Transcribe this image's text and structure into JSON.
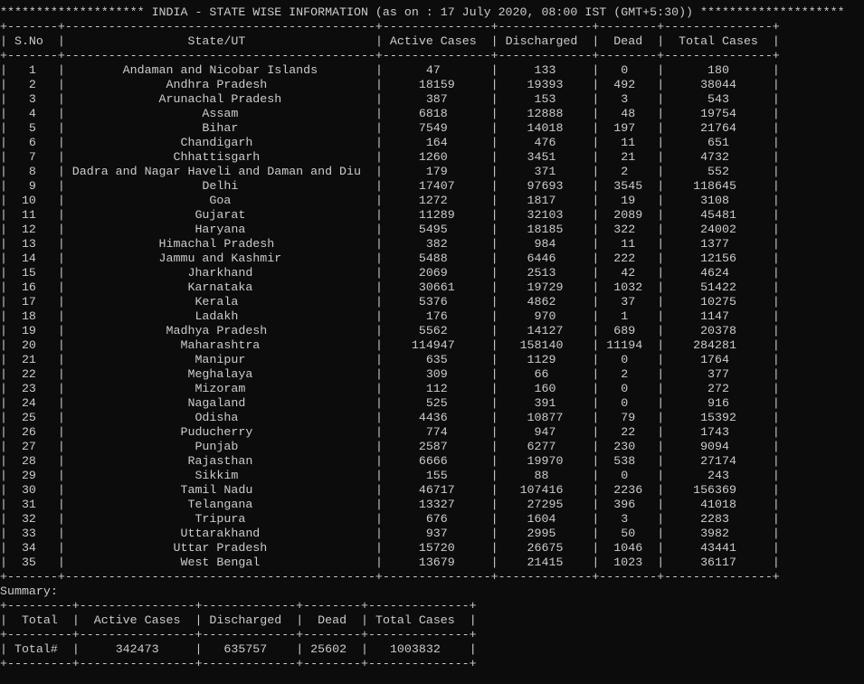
{
  "header": {
    "title": "INDIA - STATE WISE INFORMATION",
    "timestamp": "(as on : 17 July 2020, 08:00 IST (GMT+5:30))"
  },
  "state_table": {
    "columns": [
      "S.No",
      "State/UT",
      "Active Cases",
      "Discharged",
      "Dead",
      "Total Cases"
    ],
    "rows": [
      [
        "1",
        "Andaman and Nicobar Islands",
        "47",
        "133",
        "0",
        "180"
      ],
      [
        "2",
        "Andhra Pradesh",
        "18159",
        "19393",
        "492",
        "38044"
      ],
      [
        "3",
        "Arunachal Pradesh",
        "387",
        "153",
        "3",
        "543"
      ],
      [
        "4",
        "Assam",
        "6818",
        "12888",
        "48",
        "19754"
      ],
      [
        "5",
        "Bihar",
        "7549",
        "14018",
        "197",
        "21764"
      ],
      [
        "6",
        "Chandigarh",
        "164",
        "476",
        "11",
        "651"
      ],
      [
        "7",
        "Chhattisgarh",
        "1260",
        "3451",
        "21",
        "4732"
      ],
      [
        "8",
        "Dadra and Nagar Haveli and Daman and Diu",
        "179",
        "371",
        "2",
        "552"
      ],
      [
        "9",
        "Delhi",
        "17407",
        "97693",
        "3545",
        "118645"
      ],
      [
        "10",
        "Goa",
        "1272",
        "1817",
        "19",
        "3108"
      ],
      [
        "11",
        "Gujarat",
        "11289",
        "32103",
        "2089",
        "45481"
      ],
      [
        "12",
        "Haryana",
        "5495",
        "18185",
        "322",
        "24002"
      ],
      [
        "13",
        "Himachal Pradesh",
        "382",
        "984",
        "11",
        "1377"
      ],
      [
        "14",
        "Jammu and Kashmir",
        "5488",
        "6446",
        "222",
        "12156"
      ],
      [
        "15",
        "Jharkhand",
        "2069",
        "2513",
        "42",
        "4624"
      ],
      [
        "16",
        "Karnataka",
        "30661",
        "19729",
        "1032",
        "51422"
      ],
      [
        "17",
        "Kerala",
        "5376",
        "4862",
        "37",
        "10275"
      ],
      [
        "18",
        "Ladakh",
        "176",
        "970",
        "1",
        "1147"
      ],
      [
        "19",
        "Madhya Pradesh",
        "5562",
        "14127",
        "689",
        "20378"
      ],
      [
        "20",
        "Maharashtra",
        "114947",
        "158140",
        "11194",
        "284281"
      ],
      [
        "21",
        "Manipur",
        "635",
        "1129",
        "0",
        "1764"
      ],
      [
        "22",
        "Meghalaya",
        "309",
        "66",
        "2",
        "377"
      ],
      [
        "23",
        "Mizoram",
        "112",
        "160",
        "0",
        "272"
      ],
      [
        "24",
        "Nagaland",
        "525",
        "391",
        "0",
        "916"
      ],
      [
        "25",
        "Odisha",
        "4436",
        "10877",
        "79",
        "15392"
      ],
      [
        "26",
        "Puducherry",
        "774",
        "947",
        "22",
        "1743"
      ],
      [
        "27",
        "Punjab",
        "2587",
        "6277",
        "230",
        "9094"
      ],
      [
        "28",
        "Rajasthan",
        "6666",
        "19970",
        "538",
        "27174"
      ],
      [
        "29",
        "Sikkim",
        "155",
        "88",
        "0",
        "243"
      ],
      [
        "30",
        "Tamil Nadu",
        "46717",
        "107416",
        "2236",
        "156369"
      ],
      [
        "31",
        "Telangana",
        "13327",
        "27295",
        "396",
        "41018"
      ],
      [
        "32",
        "Tripura",
        "676",
        "1604",
        "3",
        "2283"
      ],
      [
        "33",
        "Uttarakhand",
        "937",
        "2995",
        "50",
        "3982"
      ],
      [
        "34",
        "Uttar Pradesh",
        "15720",
        "26675",
        "1046",
        "43441"
      ],
      [
        "35",
        "West Bengal",
        "13679",
        "21415",
        "1023",
        "36117"
      ]
    ]
  },
  "summary": {
    "label": "Summary:",
    "columns": [
      "Total",
      "Active Cases",
      "Discharged",
      "Dead",
      "Total Cases"
    ],
    "rows": [
      [
        "Total#",
        "342473",
        "635757",
        "25602",
        "1003832"
      ]
    ]
  }
}
